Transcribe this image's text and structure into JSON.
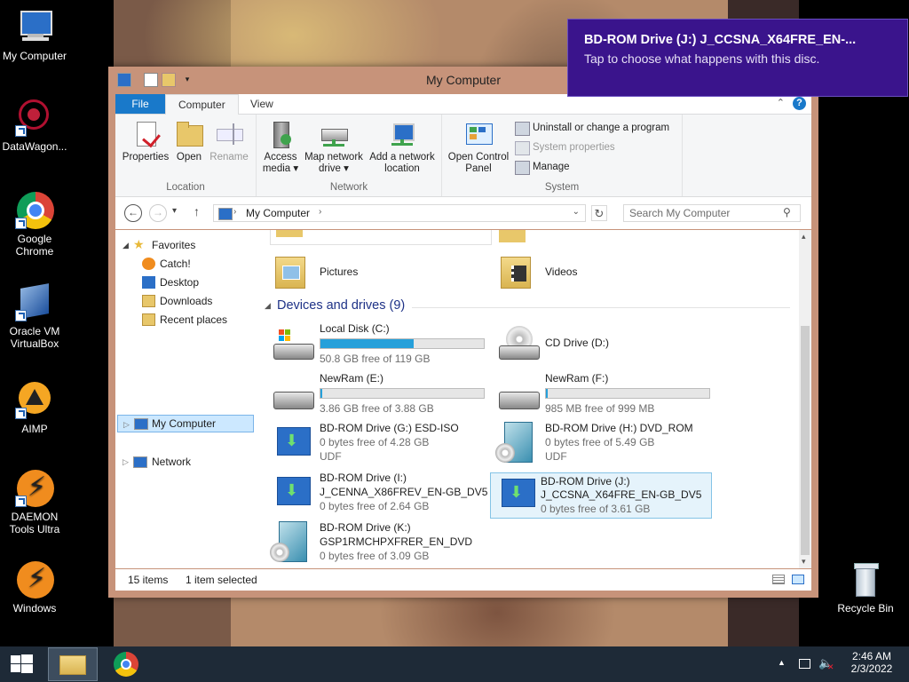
{
  "desktop": {
    "icons": [
      {
        "label": "My Computer"
      },
      {
        "label": "DataWagon..."
      },
      {
        "label": "Google Chrome"
      },
      {
        "label": "Oracle VM VirtualBox"
      },
      {
        "label": "AIMP"
      },
      {
        "label": "DAEMON Tools Ultra"
      },
      {
        "label": "Windows"
      },
      {
        "label": "Recycle Bin"
      }
    ]
  },
  "toast": {
    "title": "BD-ROM Drive (J:) J_CCSNA_X64FRE_EN-...",
    "message": "Tap to choose what happens with this disc."
  },
  "window": {
    "title": "My Computer",
    "tabs": {
      "file": "File",
      "computer": "Computer",
      "view": "View"
    },
    "ribbon": {
      "location": {
        "label": "Location",
        "properties": "Properties",
        "open": "Open",
        "rename": "Rename"
      },
      "network": {
        "label": "Network",
        "access_media_1": "Access",
        "access_media_2": "media",
        "map_drive_1": "Map network",
        "map_drive_2": "drive",
        "add_location_1": "Add a network",
        "add_location_2": "location"
      },
      "system": {
        "label": "System",
        "open_cp_1": "Open Control",
        "open_cp_2": "Panel",
        "uninstall": "Uninstall or change a program",
        "system_properties": "System properties",
        "manage": "Manage"
      }
    },
    "address": {
      "path": "My Computer"
    },
    "search": {
      "placeholder": "Search My Computer"
    },
    "nav": {
      "favorites": "Favorites",
      "catch": "Catch!",
      "desktop": "Desktop",
      "downloads": "Downloads",
      "recent": "Recent places",
      "mycomputer": "My Computer",
      "network": "Network"
    },
    "folders": {
      "pictures": "Pictures",
      "videos": "Videos"
    },
    "devices_header": "Devices and drives (9)",
    "drives": {
      "c": {
        "name": "Local Disk (C:)",
        "free": "50.8 GB free of 119 GB",
        "used_fraction": 0.57
      },
      "d": {
        "name": "CD Drive (D:)"
      },
      "e": {
        "name": "NewRam (E:)",
        "free": "3.86 GB free of 3.88 GB",
        "used_fraction": 0.01
      },
      "f": {
        "name": "NewRam (F:)",
        "free": "985 MB free of 999 MB",
        "used_fraction": 0.01
      },
      "g": {
        "name": "BD-ROM Drive (G:) ESD-ISO",
        "free": "0 bytes free of 4.28 GB",
        "fs": "UDF"
      },
      "h": {
        "name": "BD-ROM Drive (H:) DVD_ROM",
        "free": "0 bytes free of 5.49 GB",
        "fs": "UDF"
      },
      "i": {
        "name": "BD-ROM Drive (I:)",
        "label": "J_CENNA_X86FREV_EN-GB_DV5",
        "free": "0 bytes free of 2.64 GB"
      },
      "j": {
        "name": "BD-ROM Drive (J:)",
        "label": "J_CCSNA_X64FRE_EN-GB_DV5",
        "free": "0 bytes free of 3.61 GB"
      },
      "k": {
        "name": "BD-ROM Drive (K:)",
        "label": "GSP1RMCHPXFRER_EN_DVD",
        "free": "0 bytes free of 3.09 GB"
      }
    },
    "status": {
      "items": "15 items",
      "selected": "1 item selected"
    }
  },
  "taskbar": {
    "time": "2:46 AM",
    "date": "2/3/2022"
  },
  "colors": {
    "accent": "#1979ca",
    "toast": "#3a148c",
    "selection": "#cce8ff",
    "bar": "#26a0da"
  }
}
